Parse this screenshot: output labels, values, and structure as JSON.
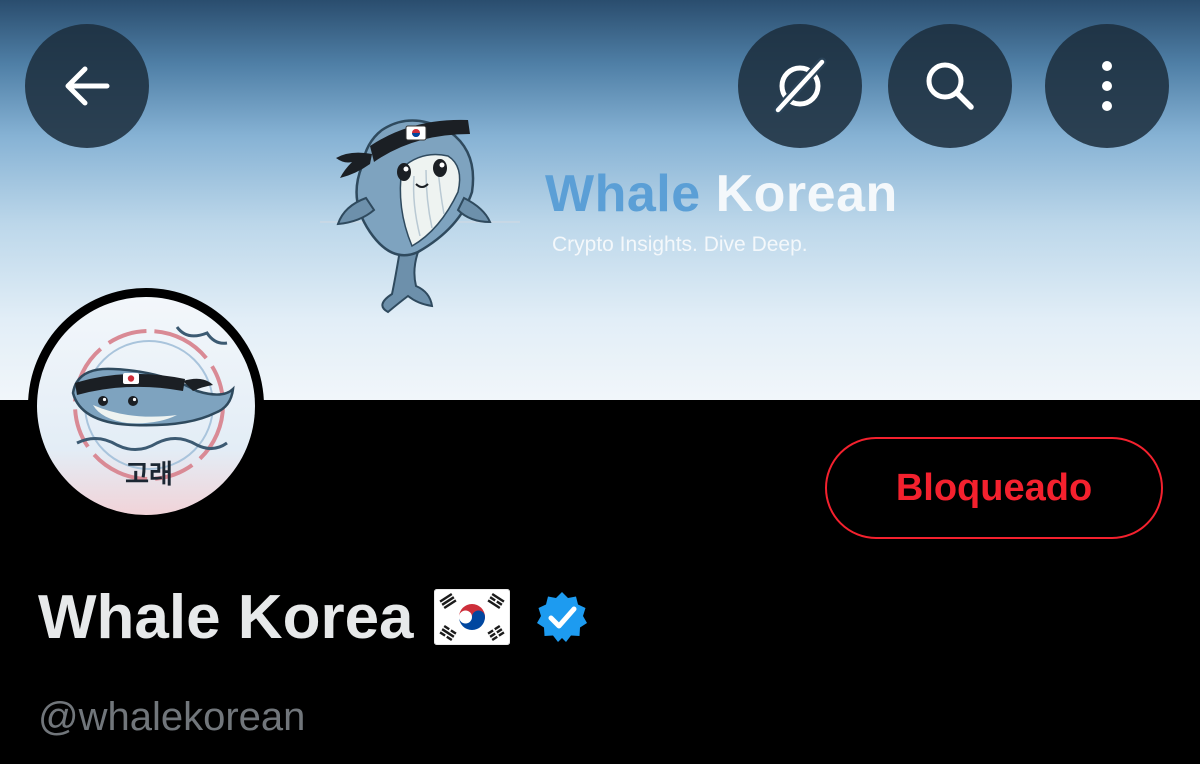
{
  "banner": {
    "brand_word_1": "Whale",
    "brand_word_2": "Korean",
    "tagline": "Crypto Insights. Dive Deep.",
    "accent_blue": "#5b9fd6"
  },
  "header": {
    "back_icon": "arrow-left-icon",
    "grok_icon": "grok-icon",
    "search_icon": "search-icon",
    "more_icon": "more-vertical-icon"
  },
  "avatar": {
    "icon": "whale-avatar",
    "lettering": "고래"
  },
  "actions": {
    "blocked_label": "Bloqueado",
    "blocked_color": "#f4212e"
  },
  "profile": {
    "display_name": "Whale Korea",
    "flag_icon": "south-korea-flag-icon",
    "verified_icon": "verified-badge-icon",
    "verified_color": "#1d9bf0",
    "handle": "@whalekorean"
  }
}
